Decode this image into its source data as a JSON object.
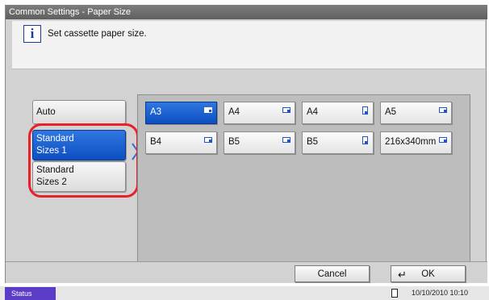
{
  "window": {
    "title": "Common Settings - Paper Size"
  },
  "message": {
    "icon": "info-icon",
    "text": "Set cassette paper size."
  },
  "left_menu": [
    {
      "label": "Auto",
      "selected": false
    },
    {
      "label": "Standard\nSizes 1",
      "selected": true
    },
    {
      "label": "Standard\nSizes 2",
      "selected": false
    }
  ],
  "paper_sizes": [
    {
      "label": "A3",
      "orientation": "landscape",
      "selected": true
    },
    {
      "label": "A4",
      "orientation": "landscape",
      "selected": false
    },
    {
      "label": "A4",
      "orientation": "portrait",
      "selected": false
    },
    {
      "label": "A5",
      "orientation": "landscape",
      "selected": false
    },
    {
      "label": "B4",
      "orientation": "landscape",
      "selected": false
    },
    {
      "label": "B5",
      "orientation": "landscape",
      "selected": false
    },
    {
      "label": "B5",
      "orientation": "portrait",
      "selected": false
    },
    {
      "label": "216x340mm",
      "orientation": "landscape",
      "selected": false
    }
  ],
  "actions": {
    "cancel_label": "Cancel",
    "ok_label": "OK",
    "ok_icon": "enter-icon"
  },
  "status_bar": {
    "status_label": "Status",
    "datetime": "10/10/2010 10:10",
    "doc_icon": "document-icon"
  },
  "colors": {
    "selected": "#0d4fc2",
    "highlight_ring": "#e8202a",
    "status_button": "#5a3cc7"
  }
}
